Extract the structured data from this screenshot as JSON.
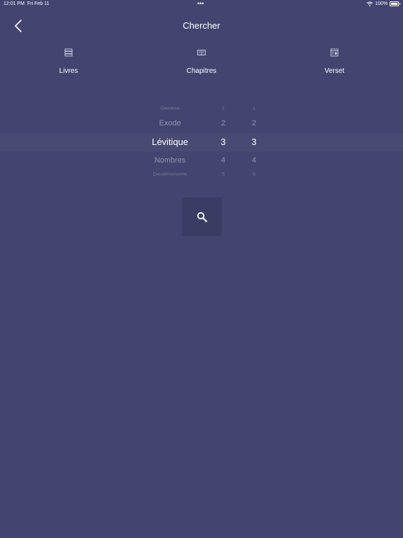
{
  "status_bar": {
    "time": "12:01 PM",
    "date": "Fri Feb 11",
    "dots": "•••",
    "battery": "100%"
  },
  "nav": {
    "back_icon": "chevron-left-icon",
    "title": "Chercher"
  },
  "tabs": [
    {
      "label": "Livres",
      "icon": "books-icon"
    },
    {
      "label": "Chapitres",
      "icon": "open-book-icon"
    },
    {
      "label": "Verset",
      "icon": "verse-icon"
    }
  ],
  "picker": {
    "books": [
      "Genèse",
      "Exode",
      "Lévitique",
      "Nombres",
      "Deutéronome"
    ],
    "chapters": [
      "1",
      "2",
      "3",
      "4",
      "5"
    ],
    "verses": [
      "1",
      "2",
      "3",
      "4",
      "5"
    ],
    "selected_book": "Lévitique",
    "selected_chapter": "3",
    "selected_verse": "3"
  },
  "search_button": {
    "icon": "search-icon"
  },
  "colors": {
    "background": "#43446f",
    "button": "#3b3c63",
    "text": "#ffffff"
  }
}
